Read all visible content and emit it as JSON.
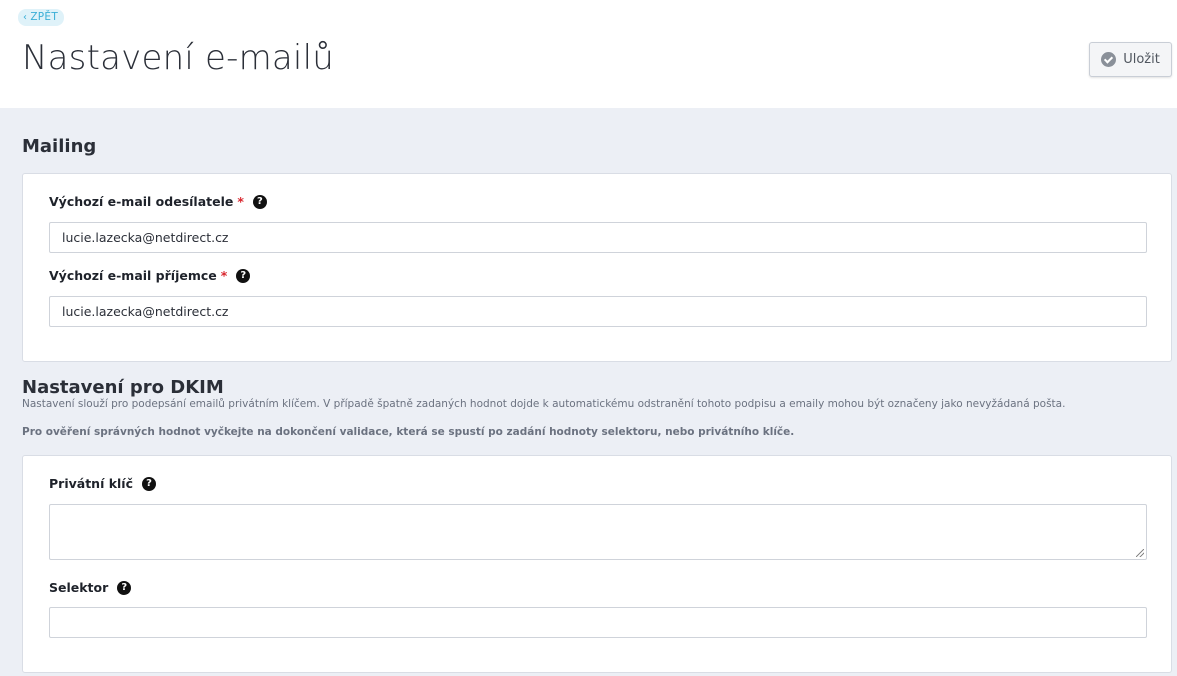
{
  "header": {
    "back_label": "ZPĚT",
    "title": "Nastavení e-mailů",
    "save_label": "Uložit"
  },
  "mailing": {
    "title": "Mailing",
    "sender_label": "Výchozí e-mail odesílatele",
    "sender_value": "lucie.lazecka@netdirect.cz",
    "recipient_label": "Výchozí e-mail příjemce",
    "recipient_value": "lucie.lazecka@netdirect.cz",
    "required_mark": "*",
    "help_glyph": "?"
  },
  "dkim": {
    "title": "Nastavení pro DKIM",
    "description": "Nastavení slouží pro podepsání emailů privátním klíčem. V případě špatně zadaných hodnot dojde k automatickému odstranění tohoto podpisu a emaily mohou být označeny jako nevyžádaná pošta.",
    "validation_note": "Pro ověření správných hodnot vyčkejte na dokončení validace, která se spustí po zadání hodnoty selektoru, nebo privátního klíče.",
    "private_key_label": "Privátní klíč",
    "private_key_value": "",
    "selector_label": "Selektor",
    "selector_value": ""
  },
  "colors": {
    "accent": "#3aaed6",
    "required": "#d9262e",
    "background": "#eceff5"
  }
}
